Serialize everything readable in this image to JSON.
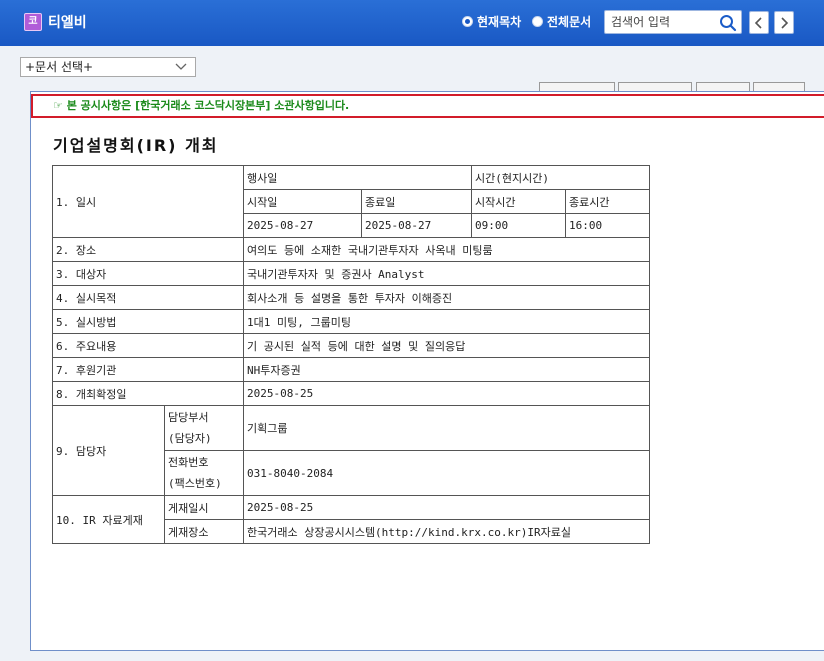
{
  "app": {
    "logo_char": "코",
    "title": "티엘비"
  },
  "scope": {
    "current_label": "현재목차",
    "all_label": "전체문서"
  },
  "search": {
    "placeholder": "검색어 입력"
  },
  "doc_select": {
    "value": "+문서 선택+"
  },
  "notice": {
    "text": "☞ 본 공시사항은 [한국거래소 코스닥시장본부] 소관사항입니다."
  },
  "document": {
    "title": "기업설명회(IR) 개최",
    "table": {
      "r1_label": "1. 일시",
      "event_date_header": "행사일",
      "time_header": "시간(현지시간)",
      "start_date_label": "시작일",
      "end_date_label": "종료일",
      "start_time_label": "시작시간",
      "end_time_label": "종료시간",
      "start_date": "2025-08-27",
      "end_date": "2025-08-27",
      "start_time": "09:00",
      "end_time": "16:00",
      "r2_label": "2. 장소",
      "r2_value": "여의도 등에 소재한 국내기관투자자 사옥내 미팅룸",
      "r3_label": "3. 대상자",
      "r3_value": "국내기관투자자 및 증권사 Analyst",
      "r4_label": "4. 실시목적",
      "r4_value": "회사소개 등 설명을 통한 투자자 이해증진",
      "r5_label": "5. 실시방법",
      "r5_value": "1대1 미팅, 그룹미팅",
      "r6_label": "6. 주요내용",
      "r6_value": "기 공시된 실적 등에 대한 설명 및 질의응답",
      "r7_label": "7. 후원기관",
      "r7_value": "NH투자증권",
      "r8_label": "8. 개최확정일",
      "r8_value": "2025-08-25",
      "r9_label": "9. 담당자",
      "r9_dept_label_1": "담당부서",
      "r9_dept_label_2": "(담당자)",
      "r9_dept_value": "기획그룹",
      "r9_phone_label_1": "전화번호",
      "r9_phone_label_2": "(팩스번호)",
      "r9_phone_value": "031-8040-2084",
      "r10_label": "10. IR 자료게재",
      "r10_date_label": "게재일시",
      "r10_date_value": "2025-08-25",
      "r10_place_label": "게재장소",
      "r10_place_value": "한국거래소 상장공시시스템(http://kind.krx.co.kr)IR자료실"
    }
  }
}
